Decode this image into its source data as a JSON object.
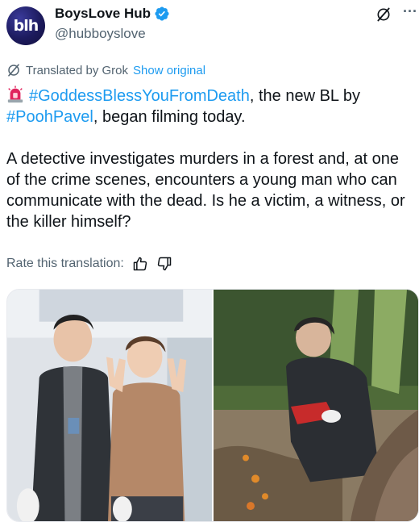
{
  "author": {
    "display_name": "BoysLove Hub",
    "handle": "@hubboyslove",
    "avatar_text": "blh",
    "verified": true
  },
  "icons": {
    "verified": "verified-badge-icon",
    "grok": "grok-icon",
    "more": "more-icon",
    "thumbs_up": "thumbs-up-icon",
    "thumbs_down": "thumbs-down-icon",
    "siren": "siren-emoji-icon"
  },
  "translation": {
    "label": "Translated by Grok",
    "show_original": "Show original"
  },
  "tweet": {
    "hashtag_1": "#GoddessBlessYouFromDeath",
    "text_1": ", the new BL by",
    "hashtag_2": "#PoohPavel",
    "text_2": ", began filming today.",
    "paragraph_2": "A detective investigates murders in a forest and, at one of the crime scenes, encounters a young man who can communicate with the dead. Is he a victim, a witness, or the killer himself?"
  },
  "rate": {
    "label": "Rate this translation:"
  },
  "more_label": "···",
  "colors": {
    "accent": "#1d9bf0",
    "text": "#0f1419",
    "muted": "#536471",
    "siren": "#e0245e"
  }
}
